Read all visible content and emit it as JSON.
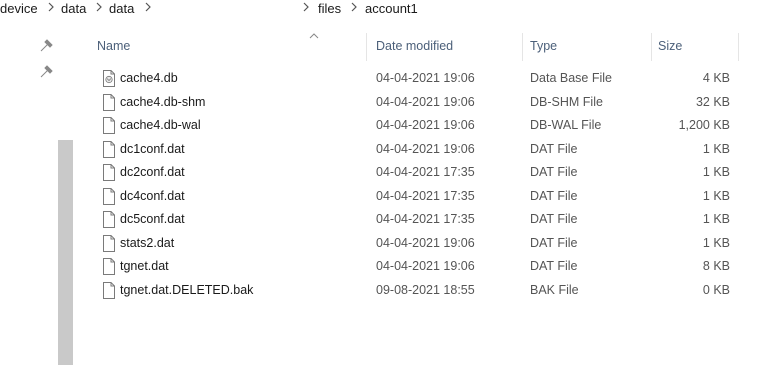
{
  "breadcrumb": {
    "items": [
      "device",
      "data",
      "data",
      "files",
      "account1"
    ],
    "separator": ">"
  },
  "columns": {
    "name": "Name",
    "date_modified": "Date modified",
    "type": "Type",
    "size": "Size"
  },
  "files": [
    {
      "name": "cache4.db",
      "date": "04-04-2021 19:06",
      "type": "Data Base File",
      "size": "4 KB",
      "icon": "database-file-icon"
    },
    {
      "name": "cache4.db-shm",
      "date": "04-04-2021 19:06",
      "type": "DB-SHM File",
      "size": "32 KB",
      "icon": "file-icon"
    },
    {
      "name": "cache4.db-wal",
      "date": "04-04-2021 19:06",
      "type": "DB-WAL File",
      "size": "1,200 KB",
      "icon": "file-icon"
    },
    {
      "name": "dc1conf.dat",
      "date": "04-04-2021 19:06",
      "type": "DAT File",
      "size": "1 KB",
      "icon": "file-icon"
    },
    {
      "name": "dc2conf.dat",
      "date": "04-04-2021 17:35",
      "type": "DAT File",
      "size": "1 KB",
      "icon": "file-icon"
    },
    {
      "name": "dc4conf.dat",
      "date": "04-04-2021 17:35",
      "type": "DAT File",
      "size": "1 KB",
      "icon": "file-icon"
    },
    {
      "name": "dc5conf.dat",
      "date": "04-04-2021 17:35",
      "type": "DAT File",
      "size": "1 KB",
      "icon": "file-icon"
    },
    {
      "name": "stats2.dat",
      "date": "04-04-2021 19:06",
      "type": "DAT File",
      "size": "1 KB",
      "icon": "file-icon"
    },
    {
      "name": "tgnet.dat",
      "date": "04-04-2021 19:06",
      "type": "DAT File",
      "size": "8 KB",
      "icon": "file-icon"
    },
    {
      "name": "tgnet.dat.DELETED.bak",
      "date": "09-08-2021 18:55",
      "type": "BAK File",
      "size": "0 KB",
      "icon": "file-icon"
    }
  ],
  "colors": {
    "header_text": "#4c607a",
    "secondary_text": "#555555",
    "scrollbar_thumb": "#c9c9c9"
  }
}
